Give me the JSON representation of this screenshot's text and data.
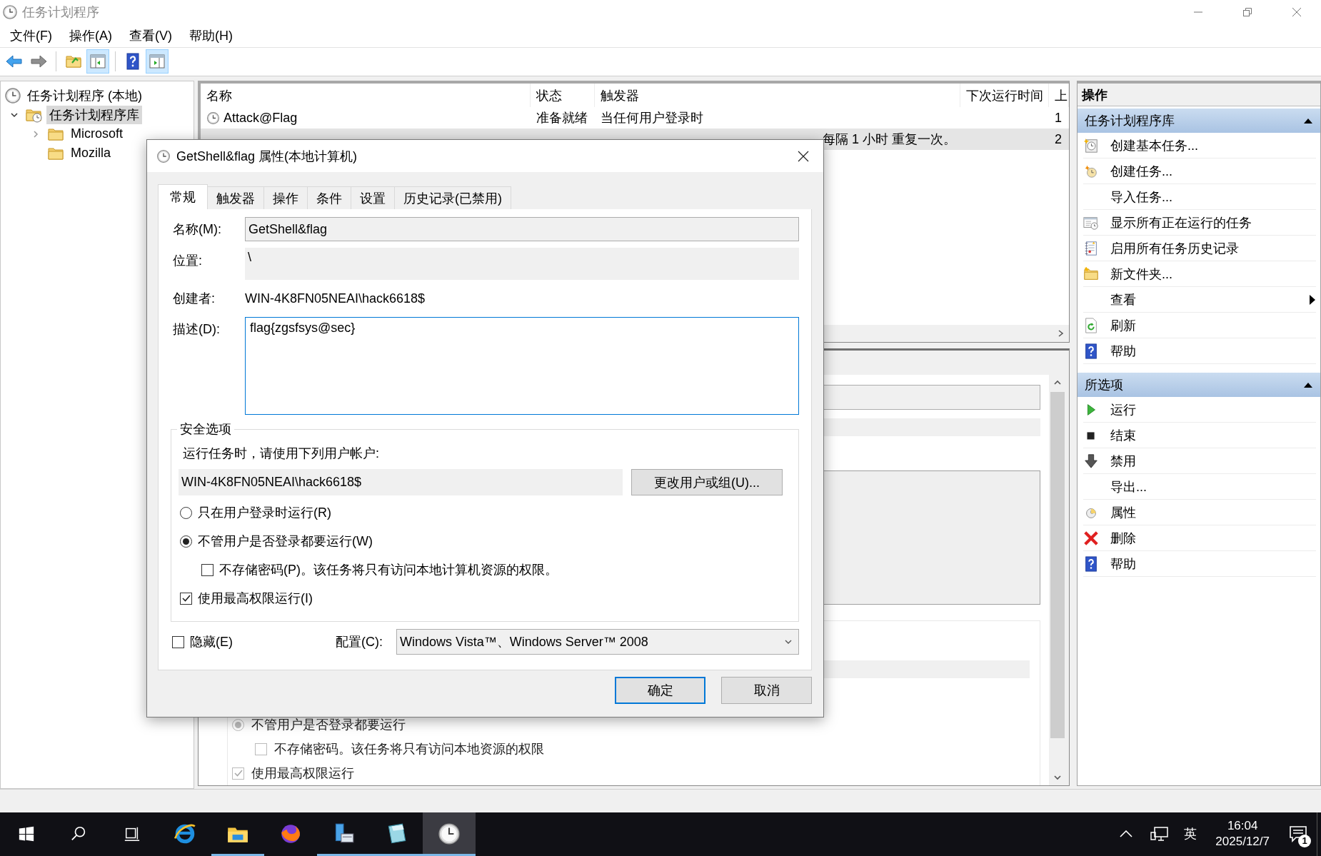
{
  "window": {
    "title": "任务计划程序"
  },
  "menu": [
    "文件(F)",
    "操作(A)",
    "查看(V)",
    "帮助(H)"
  ],
  "toolbar": [
    {
      "pressed": false
    },
    {
      "pressed": false
    },
    {
      "pressed": false
    },
    {
      "pressed": true
    },
    {
      "pressed": false
    },
    {
      "pressed": true
    }
  ],
  "tree": [
    {
      "label": "任务计划程序 (本地)",
      "selected": false,
      "children": [
        {
          "label": "任务计划程序库",
          "expanded": true,
          "selected": true,
          "children": [
            {
              "label": "Microsoft",
              "expanded": false,
              "selected": false
            },
            {
              "label": "Mozilla",
              "selected": false
            }
          ]
        }
      ]
    }
  ],
  "task_list": {
    "columns": [
      "名称",
      "状态",
      "触发器",
      "下次运行时间",
      "上"
    ],
    "rows": [
      {
        "name": "Attack@Flag",
        "status": "准备就绪",
        "trigger": "当任何用户登录时",
        "column_5": "1",
        "selected": false
      },
      {
        "trigger": "每隔 1 小时 重复一次。",
        "column_5": "2",
        "selected": true
      }
    ]
  },
  "detail_pane": {
    "items": [
      {
        "kind": "radio",
        "label": "不管用户是否登录都要运行",
        "selected": true
      },
      {
        "kind": "checkbox",
        "label": "不存储密码。该任务将只有访问本地资源的权限",
        "checked": false
      },
      {
        "kind": "checkbox",
        "label": "使用最高权限运行",
        "checked": true
      }
    ]
  },
  "actions": {
    "title": "操作",
    "sections": [
      {
        "title": "任务计划程序库",
        "expanded": true,
        "items": [
          {
            "label": "创建基本任务..."
          },
          {
            "label": "创建任务..."
          },
          {
            "label": "导入任务..."
          },
          {
            "label": "显示所有正在运行的任务"
          },
          {
            "label": "启用所有任务历史记录"
          },
          {
            "label": "新文件夹..."
          },
          {
            "label": "查看",
            "submenu": true
          },
          {
            "label": "刷新"
          },
          {
            "label": "帮助"
          }
        ]
      },
      {
        "title": "所选项",
        "expanded": true,
        "items": [
          {
            "label": "运行"
          },
          {
            "label": "结束"
          },
          {
            "label": "禁用"
          },
          {
            "label": "导出..."
          },
          {
            "label": "属性"
          },
          {
            "label": "删除"
          },
          {
            "label": "帮助"
          }
        ]
      }
    ]
  },
  "dialog": {
    "title": "GetShell&flag 属性(本地计算机)",
    "tabs": [
      {
        "label": "常规",
        "selected": true
      },
      {
        "label": "触发器",
        "selected": false
      },
      {
        "label": "操作",
        "selected": false
      },
      {
        "label": "条件",
        "selected": false
      },
      {
        "label": "设置",
        "selected": false
      },
      {
        "label": "历史记录(已禁用)",
        "selected": false
      }
    ],
    "name_label": "名称(M):",
    "name_value": "GetShell&flag",
    "location_label": "位置:",
    "location_value": "\\",
    "author_label": "创建者:",
    "author_value": "WIN-4K8FN05NEAI\\hack6618$",
    "description_label": "描述(D):",
    "description_value": "flag{zgsfsys@sec}",
    "security": {
      "title": "安全选项",
      "prompt": "运行任务时，请使用下列用户帐户:",
      "user_account": "WIN-4K8FN05NEAI\\hack6618$",
      "change_button": "更改用户或组(U)...",
      "options": [
        {
          "kind": "radio",
          "label": "只在用户登录时运行(R)",
          "selected": false
        },
        {
          "kind": "radio",
          "label": "不管用户是否登录都要运行(W)",
          "selected": true,
          "children": [
            {
              "kind": "checkbox",
              "label": "不存储密码(P)。该任务将只有访问本地计算机资源的权限。",
              "checked": false
            }
          ]
        },
        {
          "kind": "checkbox",
          "label": "使用最高权限运行(I)",
          "checked": true
        }
      ]
    },
    "hidden": {
      "label": "隐藏(E)",
      "checked": false
    },
    "configure": {
      "label": "配置(C):",
      "value": "Windows Vista™、Windows Server™ 2008"
    },
    "buttons": [
      {
        "label": "确定",
        "default": true
      },
      {
        "label": "取消",
        "default": false
      }
    ]
  },
  "taskbar": {
    "apps": [
      {
        "running": false,
        "active": false
      },
      {
        "running": true,
        "active": false
      },
      {
        "running": false,
        "active": false
      },
      {
        "running": true,
        "active": false
      },
      {
        "running": true,
        "active": false
      },
      {
        "running": true,
        "active": true
      }
    ],
    "ime": "英",
    "time": "16:04",
    "date": "2025/12/7",
    "notifications": "1"
  }
}
